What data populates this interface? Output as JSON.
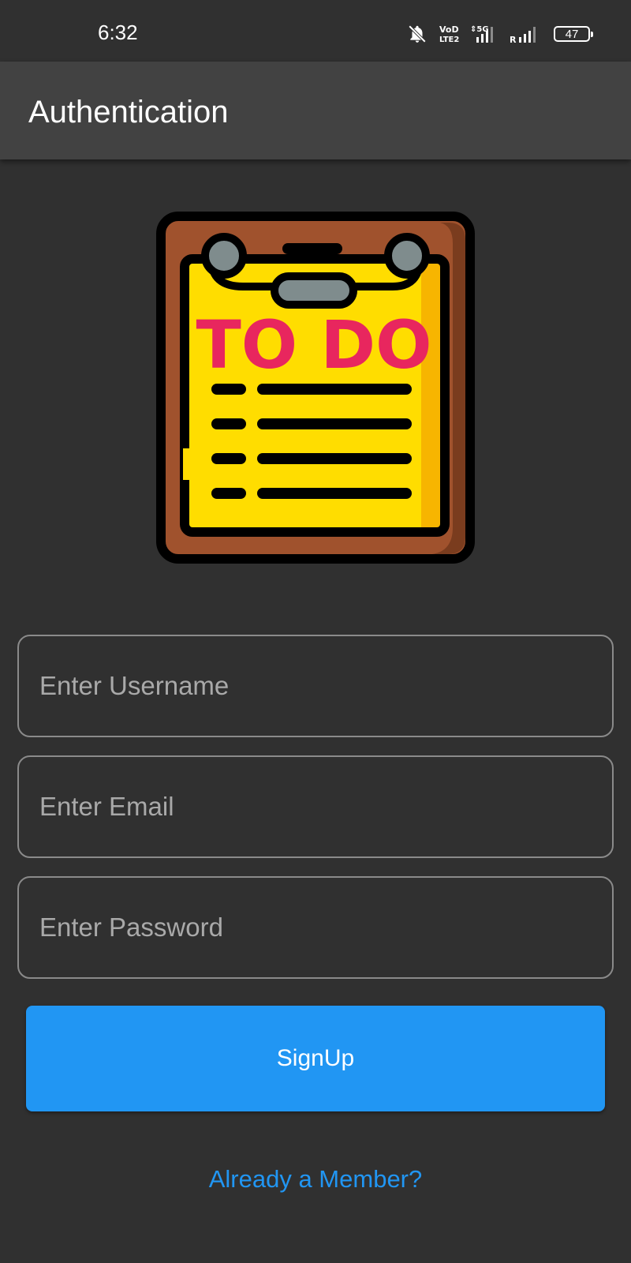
{
  "status_bar": {
    "time": "6:32",
    "battery": "47",
    "icons": [
      "bell-off-icon",
      "volte-icon",
      "signal-5g-icon",
      "signal-roaming-icon",
      "battery-icon"
    ]
  },
  "app_bar": {
    "title": "Authentication"
  },
  "logo": {
    "text": "TO DO",
    "colors": {
      "board": "#a0522d",
      "board_shadow": "#7a3c1e",
      "paper": "#ffdd00",
      "paper_shadow": "#f7b500",
      "text": "#e8265e",
      "clip": "#7f8c8d",
      "outline": "#000000"
    }
  },
  "form": {
    "username": {
      "placeholder": "Enter Username",
      "value": ""
    },
    "email": {
      "placeholder": "Enter Email",
      "value": ""
    },
    "password": {
      "placeholder": "Enter Password",
      "value": ""
    },
    "signup_label": "SignUp",
    "member_link": "Already a Member?"
  },
  "colors": {
    "background": "#303030",
    "app_bar": "#424242",
    "accent": "#2196f3",
    "field_border": "#8a8a8a"
  }
}
